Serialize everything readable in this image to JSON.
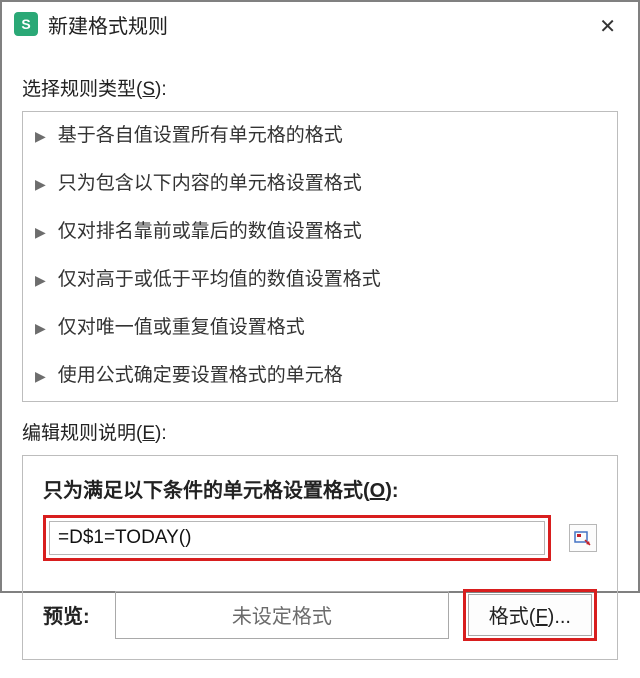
{
  "titlebar": {
    "app_icon_letter": "S",
    "title": "新建格式规则"
  },
  "section1": {
    "label_prefix": "选择规则类型(",
    "label_hotkey": "S",
    "label_suffix": "):"
  },
  "rules": {
    "items": [
      {
        "label": "基于各自值设置所有单元格的格式"
      },
      {
        "label": "只为包含以下内容的单元格设置格式"
      },
      {
        "label": "仅对排名靠前或靠后的数值设置格式"
      },
      {
        "label": "仅对高于或低于平均值的数值设置格式"
      },
      {
        "label": "仅对唯一值或重复值设置格式"
      },
      {
        "label": "使用公式确定要设置格式的单元格"
      }
    ]
  },
  "section2": {
    "label_prefix": "编辑规则说明(",
    "label_hotkey": "E",
    "label_suffix": "):"
  },
  "formula": {
    "label_prefix": "只为满足以下条件的单元格设置格式(",
    "label_hotkey": "O",
    "label_suffix": "):",
    "value": "=D$1=TODAY()"
  },
  "preview": {
    "label": "预览:",
    "text": "未设定格式"
  },
  "format_button": {
    "prefix": "格式(",
    "hotkey": "F",
    "suffix": ")..."
  }
}
